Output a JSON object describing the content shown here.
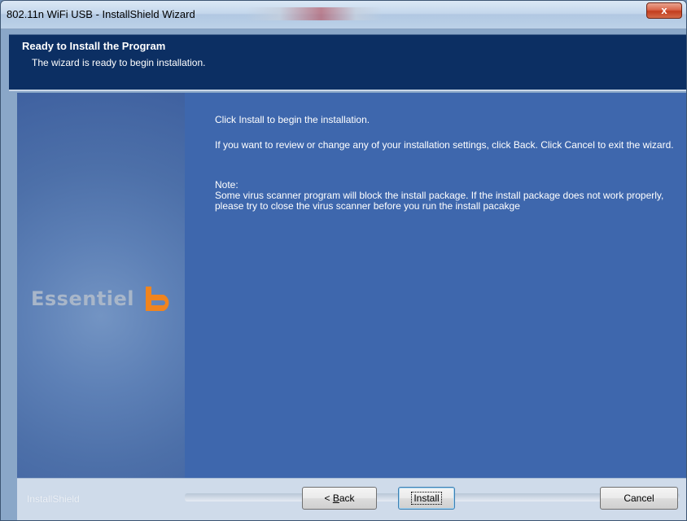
{
  "window": {
    "title": "802.11n WiFi USB - InstallShield Wizard",
    "close_label": "x"
  },
  "header": {
    "title": "Ready to Install the Program",
    "subtitle": "The wizard is ready to begin installation."
  },
  "brand": {
    "logo_text": "Essentiel",
    "logo_mark_color": "#f0841e"
  },
  "content": {
    "line1": "Click Install to begin the installation.",
    "line2": "If you want to review or change any of your installation settings, click Back. Click Cancel to exit the wizard.",
    "note_label": "Note:",
    "note_text": "Some virus scanner program will block the install package. If the install package does not work properly, please try to close the virus scanner before you run the install pacakge"
  },
  "footer": {
    "brand": "InstallShield",
    "back_prefix": "< ",
    "back_mnemonic": "B",
    "back_rest": "ack",
    "install_label": "Install",
    "cancel_label": "Cancel"
  },
  "colors": {
    "header_bg": "#0c2f63",
    "content_bg": "#3e67ad",
    "accent": "#f0841e"
  }
}
